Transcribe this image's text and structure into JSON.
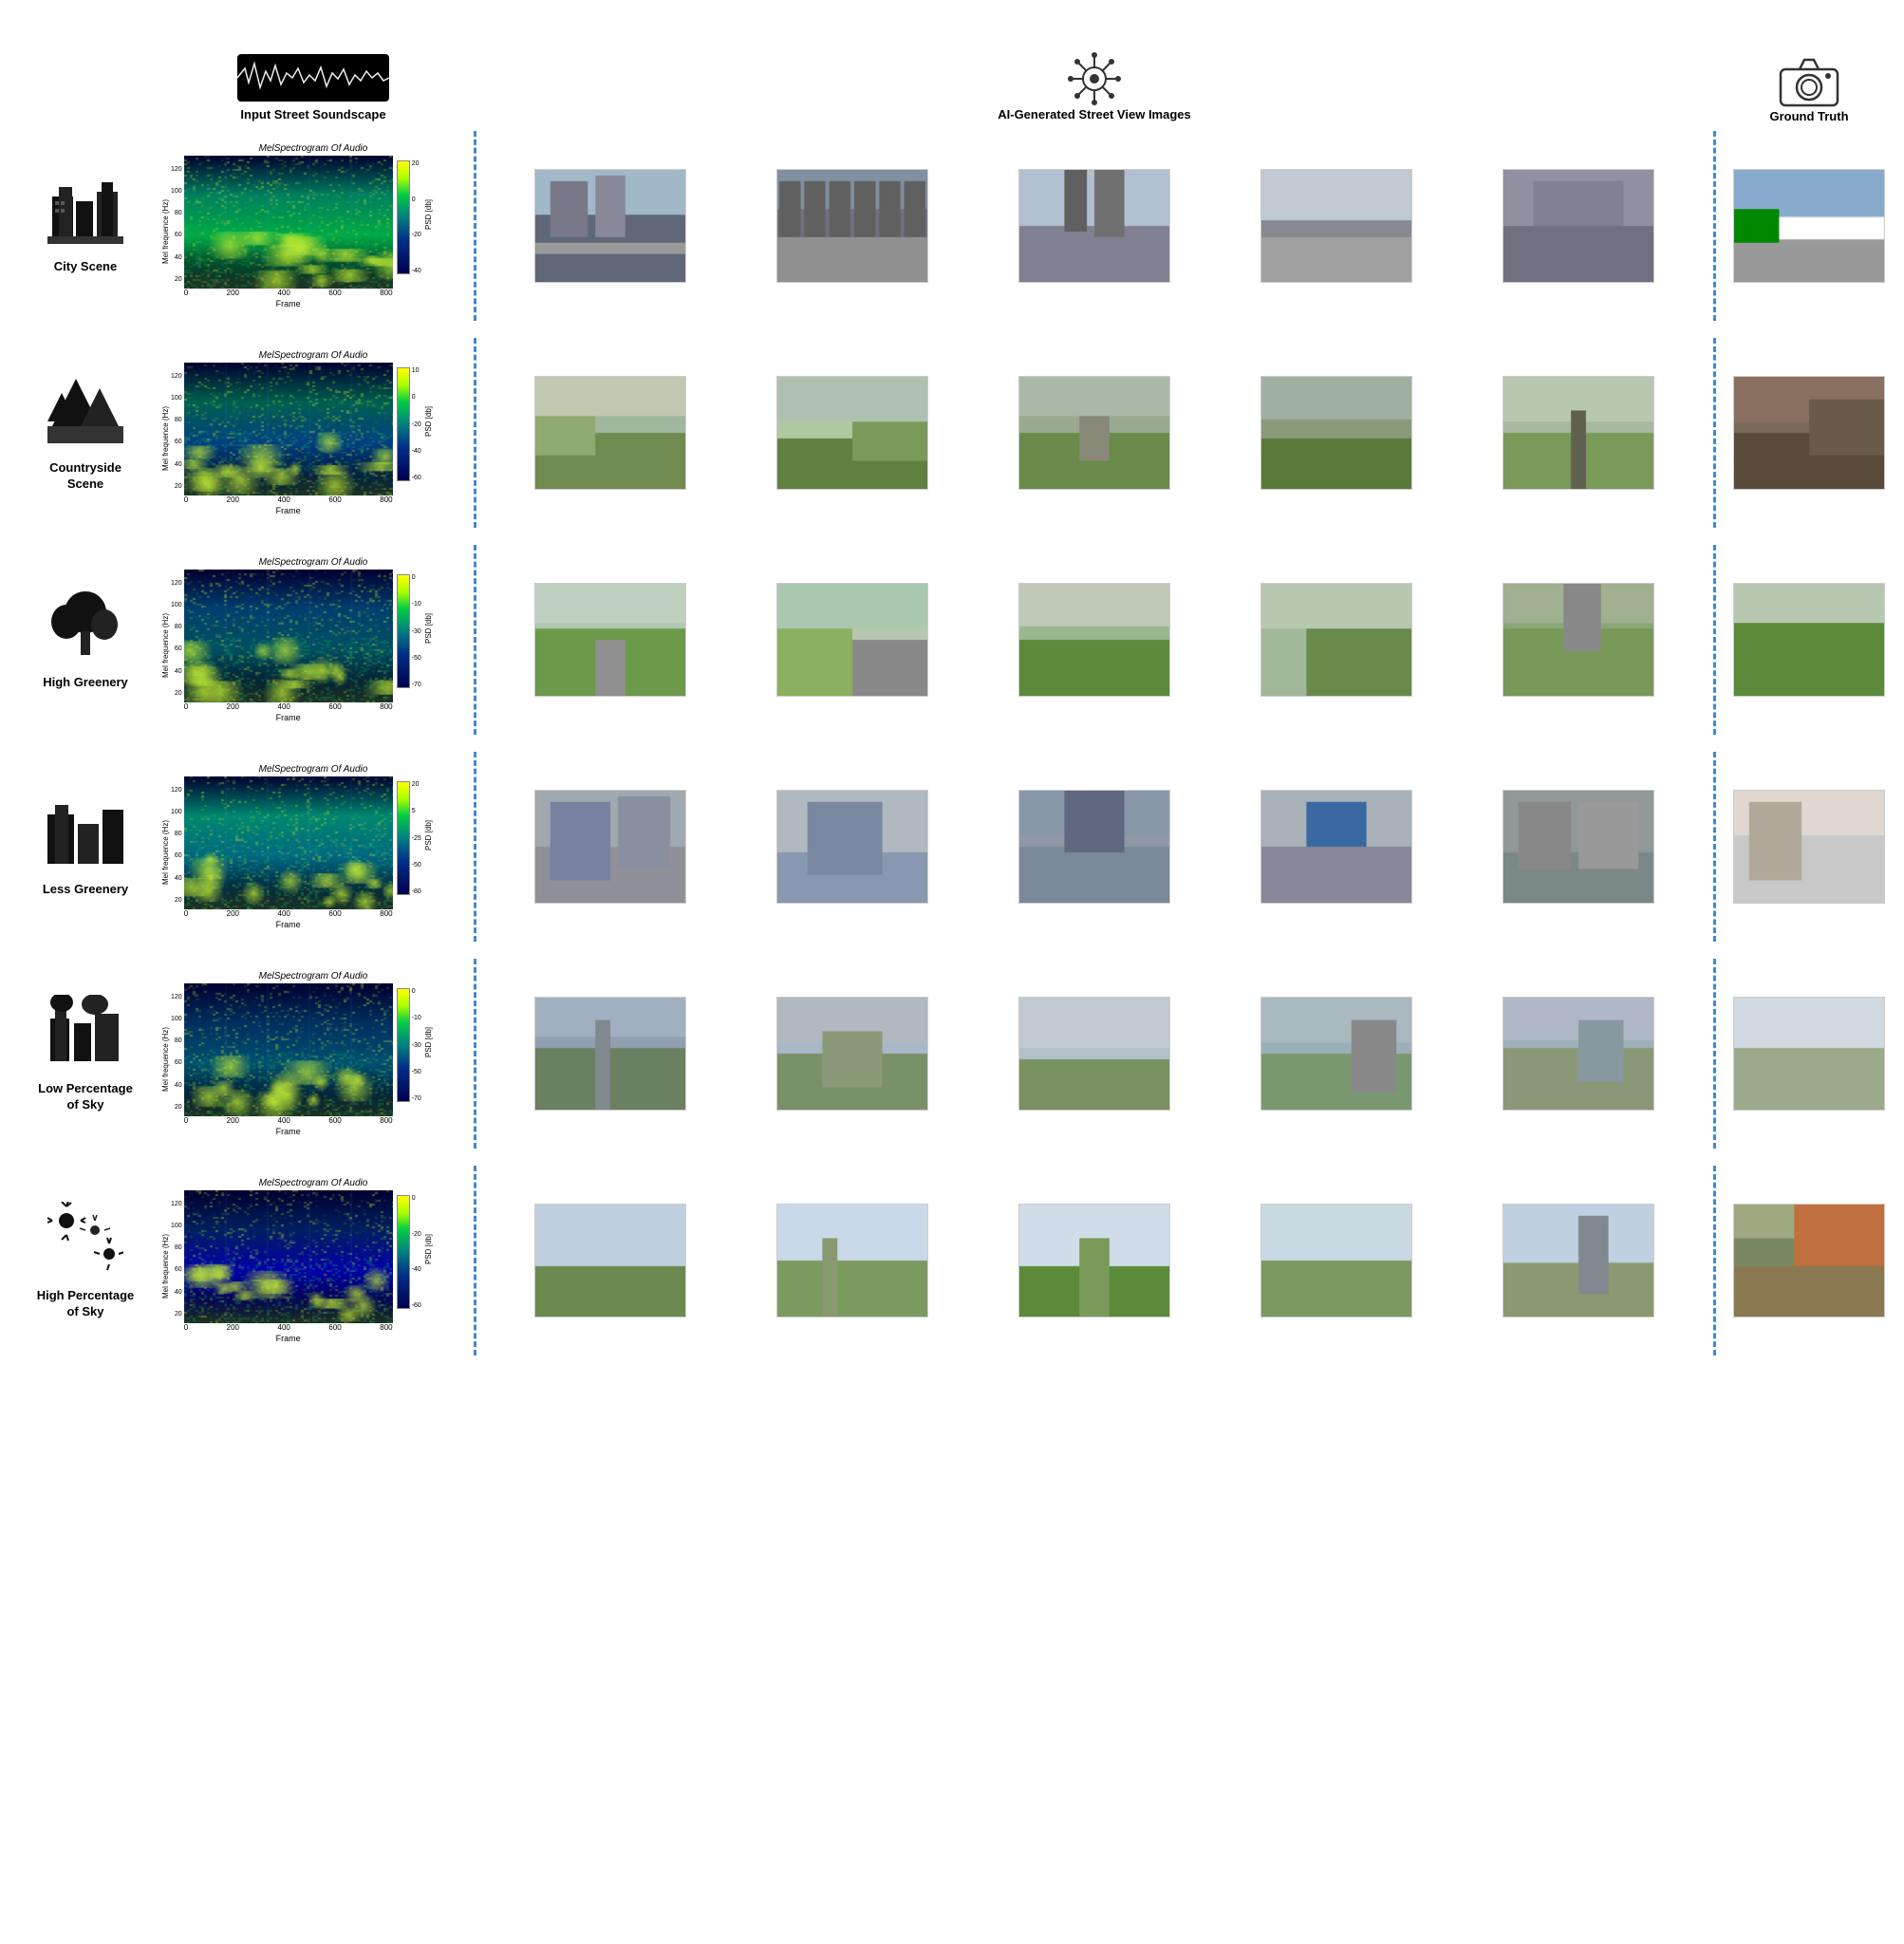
{
  "header": {
    "soundscape_icon": "〜",
    "soundscape_title": "Input Street\nSoundscape",
    "ai_icon": "⬡",
    "ai_title": "AI-Generated Street\nView Images",
    "gt_icon": "📷",
    "gt_title": "Ground Truth"
  },
  "rows": [
    {
      "id": "city",
      "icon": "🏙",
      "label": "City Scene",
      "spectrogram_title": "MelSpectrogram Of Audio",
      "y_label": "Mel frequence (Hz)",
      "y_ticks": [
        "120",
        "100",
        "80",
        "60",
        "40",
        "20",
        ""
      ],
      "x_ticks": [
        "0",
        "200",
        "400",
        "600",
        "800"
      ],
      "x_label": "Frame",
      "colorbar_ticks": [
        "20",
        "0",
        "-20",
        "-40"
      ],
      "psd_label": "PSD [db]",
      "scene_type": "city",
      "gt_type": "gt-city"
    },
    {
      "id": "countryside",
      "icon": "🌲",
      "label": "Countryside\nScene",
      "spectrogram_title": "MelSpectrogram Of Audio",
      "y_label": "Mel frequence (Hz)",
      "y_ticks": [
        "120",
        "100",
        "80",
        "60",
        "40",
        "20",
        ""
      ],
      "x_ticks": [
        "0",
        "200",
        "400",
        "600",
        "800"
      ],
      "x_label": "Frame",
      "colorbar_ticks": [
        "10",
        "0",
        "-20",
        "-40",
        "-60"
      ],
      "psd_label": "PSD [db]",
      "scene_type": "countryside",
      "gt_type": "gt-countryside"
    },
    {
      "id": "high-greenery",
      "icon": "🌿",
      "label": "High Greenery",
      "spectrogram_title": "MelSpectrogram Of Audio",
      "y_label": "Mel frequence (Hz)",
      "y_ticks": [
        "120",
        "100",
        "80",
        "60",
        "40",
        "20",
        ""
      ],
      "x_ticks": [
        "0",
        "200",
        "400",
        "600",
        "800"
      ],
      "x_label": "Frame",
      "colorbar_ticks": [
        "0",
        "-10",
        "-30",
        "-50",
        "-70"
      ],
      "psd_label": "PSD [db]",
      "scene_type": "high-greenery",
      "gt_type": "gt-highgreen"
    },
    {
      "id": "less-greenery",
      "icon": "🏢",
      "label": "Less Greenery",
      "spectrogram_title": "MelSpectrogram Of Audio",
      "y_label": "Mel frequence (Hz)",
      "y_ticks": [
        "120",
        "100",
        "80",
        "60",
        "40",
        "20",
        ""
      ],
      "x_ticks": [
        "0",
        "200",
        "400",
        "600",
        "800"
      ],
      "x_label": "Frame",
      "colorbar_ticks": [
        "20",
        "5",
        "-25",
        "-50",
        "-80"
      ],
      "psd_label": "PSD [db]",
      "scene_type": "less-greenery",
      "gt_type": "gt-lessgreen"
    },
    {
      "id": "low-sky",
      "icon": "🌆",
      "label": "Low Percentage\nof Sky",
      "spectrogram_title": "MelSpectrogram Of Audio",
      "y_label": "Mel frequence (Hz)",
      "y_ticks": [
        "120",
        "100",
        "80",
        "60",
        "40",
        "20",
        ""
      ],
      "x_ticks": [
        "0",
        "200",
        "400",
        "600",
        "800"
      ],
      "x_label": "Frame",
      "colorbar_ticks": [
        "0",
        "-10",
        "-30",
        "-50",
        "-70"
      ],
      "psd_label": "PSD [db]",
      "scene_type": "low-sky",
      "gt_type": "gt-lowsky"
    },
    {
      "id": "high-sky",
      "icon": "🎆",
      "label": "High Percentage\nof Sky",
      "spectrogram_title": "MelSpectrogram Of Audio",
      "y_label": "Mel frequence (Hz)",
      "y_ticks": [
        "120",
        "100",
        "80",
        "60",
        "40",
        "20",
        ""
      ],
      "x_ticks": [
        "0",
        "200",
        "400",
        "600",
        "800"
      ],
      "x_label": "Frame",
      "colorbar_ticks": [
        "0",
        "-20",
        "-40",
        "-60"
      ],
      "psd_label": "PSD [db]",
      "scene_type": "high-sky",
      "gt_type": "gt-highsky"
    }
  ]
}
